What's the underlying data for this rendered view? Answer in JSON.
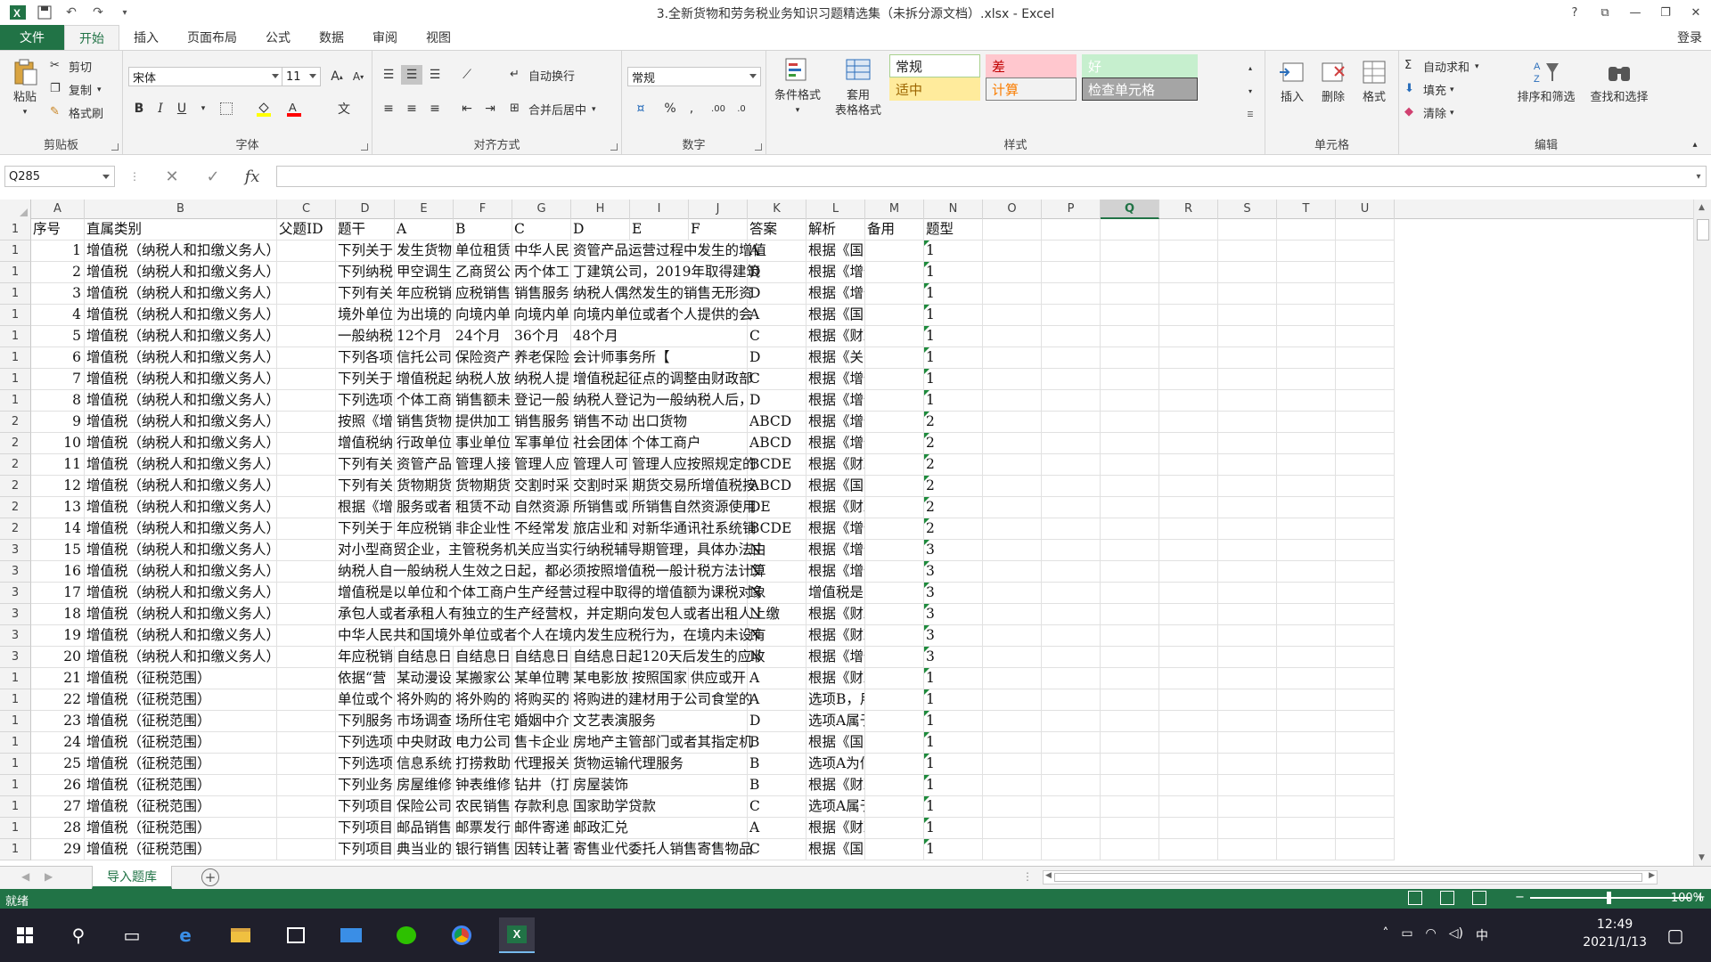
{
  "window": {
    "title": "3.全新货物和劳务税业务知识习题精选集（未拆分源文档）.xlsx - Excel",
    "help": "?",
    "login": "登录"
  },
  "ribbon_tabs": [
    "文件",
    "开始",
    "插入",
    "页面布局",
    "公式",
    "数据",
    "审阅",
    "视图"
  ],
  "clipboard": {
    "paste": "粘贴",
    "cut": "剪切",
    "copy": "复制",
    "painter": "格式刷",
    "label": "剪贴板"
  },
  "font": {
    "name": "宋体",
    "size": "11",
    "label": "字体",
    "bold": "B",
    "italic": "I",
    "underline": "U",
    "grow": "A",
    "shrink": "A",
    "phonetic": "文"
  },
  "alignment": {
    "wrap": "自动换行",
    "merge": "合并后居中",
    "label": "对齐方式"
  },
  "number": {
    "format": "常规",
    "percent": "%",
    "comma": ",",
    "label": "数字"
  },
  "styles": {
    "conditional": "条件格式",
    "table": "套用\n表格格式",
    "label": "样式",
    "cells": [
      {
        "text": "常规",
        "bg": "#ffffff",
        "fg": "#222222",
        "border": "#a9d18e"
      },
      {
        "text": "差",
        "bg": "#ffc7ce",
        "fg": "#c00000",
        "border": "#ffc7ce"
      },
      {
        "text": "好",
        "bg": "#c6efce",
        "fg": "#ffffff",
        "border": "#c6efce"
      },
      {
        "text": "适中",
        "bg": "#ffeb9c",
        "fg": "#9c6500",
        "border": "#ffeb9c"
      },
      {
        "text": "计算",
        "bg": "#f2f2f2",
        "fg": "#fa7d00",
        "border": "#7f7f7f"
      },
      {
        "text": "检查单元格",
        "bg": "#a5a5a5",
        "fg": "#ffffff",
        "border": "#3f3f3f"
      }
    ]
  },
  "cellgroup": {
    "insert": "插入",
    "delete": "删除",
    "format": "格式",
    "label": "单元格"
  },
  "editing": {
    "autosum": "自动求和",
    "fill": "填充",
    "clear": "清除",
    "sort": "排序和筛选",
    "find": "查找和选择",
    "label": "编辑"
  },
  "formula_bar": {
    "name_box": "Q285",
    "fx": "fx",
    "value": ""
  },
  "columns": [
    "A",
    "B",
    "C",
    "D",
    "E",
    "F",
    "G",
    "H",
    "I",
    "J",
    "K",
    "L",
    "M",
    "N",
    "O",
    "P",
    "Q",
    "R",
    "S",
    "T",
    "U"
  ],
  "selected_column": "Q",
  "header_row": [
    "序号",
    "直属类别",
    "父题ID",
    "题干",
    "A",
    "B",
    "C",
    "D",
    "E",
    "F",
    "答案",
    "解析",
    "备用",
    "题型"
  ],
  "rows": [
    {
      "n": "1",
      "a": "1",
      "b": "增值税（纳税人和扣缴义务人）",
      "d": "下列关于扌",
      "e": "发生货物",
      "f": "单位租赁",
      "g": "中华人民",
      "h": "资管产品运营过程中发生的增值",
      "k": "A",
      "l": "根据《国家税务总局"
    },
    {
      "n": "1",
      "a": "2",
      "b": "增值税（纳税人和扣缴义务人）",
      "d": "下列纳税",
      "e": "甲空调生",
      "f": "乙商贸公",
      "g": "丙个体工商",
      "h": "丁建筑公司，2019年取得建筑",
      "k": "D",
      "l": "根据《增值税一般纳"
    },
    {
      "n": "1",
      "a": "3",
      "b": "增值税（纳税人和扣缴义务人）",
      "d": "下列有关",
      "e": "年应税销",
      "f": "应税销售",
      "g": "销售服务",
      "h": "纳税人偶然发生的销售无形资",
      "k": "D",
      "l": "根据《增值税一般纳"
    },
    {
      "n": "1",
      "a": "4",
      "b": "增值税（纳税人和扣缴义务人）",
      "d": "境外单位",
      "e": "为出境的",
      "f": "向境内单",
      "g": "向境内单",
      "h": "向境内单位或者个人提供的会",
      "k": "A",
      "l": "根据《国家税务总局"
    },
    {
      "n": "1",
      "a": "5",
      "b": "增值税（纳税人和扣缴义务人）",
      "d": "一般纳税",
      "e": "12个月",
      "f": "24个月",
      "g": "36个月",
      "h": "48个月",
      "k": "C",
      "l": "根据《财政部、国家"
    },
    {
      "n": "1",
      "a": "6",
      "b": "增值税（纳税人和扣缴义务人）",
      "d": "下列各项",
      "e": "信托公司",
      "f": "保险资产",
      "g": "养老保险",
      "h": "会计师事务所【",
      "k": "D",
      "l": "根据《关于资管产品"
    },
    {
      "n": "1",
      "a": "7",
      "b": "增值税（纳税人和扣缴义务人）",
      "d": "下列关于",
      "e": "增值税起",
      "f": "纳税人放",
      "g": "纳税人提",
      "h": "增值税起征点的调整由财政部",
      "k": "C",
      "l": "根据《增值税暂行条"
    },
    {
      "n": "1",
      "a": "8",
      "b": "增值税（纳税人和扣缴义务人）",
      "d": "下列选项",
      "e": "个体工商",
      "f": "销售额未",
      "g": "登记一般",
      "h": "纳税人登记为一般纳税人后，",
      "k": "D",
      "l": "根据《增值税一般纳"
    },
    {
      "n": "2",
      "a": "9",
      "b": "增值税（纳税人和扣缴义务人）",
      "d": "按照《增",
      "e": "销售货物",
      "f": "提供加工",
      "g": "销售服务",
      "h": "销售不动",
      "i": "出口货物",
      "k": "ABCD",
      "l": "根据《增值税暂行条"
    },
    {
      "n": "2",
      "a": "10",
      "b": "增值税（纳税人和扣缴义务人）",
      "d": "增值税纳",
      "e": "行政单位",
      "f": "事业单位",
      "g": "军事单位",
      "h": "社会团体",
      "i": "个体工商户",
      "k": "ABCD",
      "l": "根据《增值税暂行条"
    },
    {
      "n": "2",
      "a": "11",
      "b": "增值税（纳税人和扣缴义务人）",
      "d": "下列有关",
      "e": "资管产品",
      "f": "管理人接",
      "g": "管理人应",
      "h": "管理人可",
      "i": "管理人应按照规定的",
      "k": "BCDE",
      "l": "根据《财政部、国家"
    },
    {
      "n": "2",
      "a": "12",
      "b": "增值税（纳税人和扣缴义务人）",
      "d": "下列有关",
      "e": "货物期货",
      "f": "货物期货",
      "g": "交割时采",
      "h": "交割时采",
      "i": "期货交易所增值税按",
      "k": "ABCD",
      "l": "根据《国家税务总局"
    },
    {
      "n": "2",
      "a": "13",
      "b": "增值税（纳税人和扣缴义务人）",
      "d": "根据《增",
      "e": "服务或者",
      "f": "租赁不动",
      "g": "自然资源",
      "h": "所销售或",
      "i": "所销售自然资源使用",
      "k": "DE",
      "l": "根据《财政部、国家"
    },
    {
      "n": "2",
      "a": "14",
      "b": "增值税（纳税人和扣缴义务人）",
      "d": "下列关于",
      "e": "年应税销",
      "f": "非企业性",
      "g": "不经常发",
      "h": "旅店业和",
      "i": "对新华通讯社系统销",
      "k": "BCDE",
      "l": "根据《增值税暂行条"
    },
    {
      "n": "3",
      "a": "15",
      "b": "增值税（纳税人和扣缴义务人）",
      "d": "对小型商贸企业，主管税务机关应当实行纳税辅导期管理，具体办法由",
      "k": "N",
      "l": "根据《增值税一般纳"
    },
    {
      "n": "3",
      "a": "16",
      "b": "增值税（纳税人和扣缴义务人）",
      "d": "纳税人自一般纳税人生效之日起，都必须按照增值税一般计税方法计算",
      "k": "N",
      "l": "根据《增值税一般纳"
    },
    {
      "n": "3",
      "a": "17",
      "b": "增值税（纳税人和扣缴义务人）",
      "d": "增值税是以单位和个体工商户生产经营过程中取得的增值额为课税对象",
      "k": "N",
      "l": "增值税是以单位和个"
    },
    {
      "n": "3",
      "a": "18",
      "b": "增值税（纳税人和扣缴义务人）",
      "d": "承包人或者承租人有独立的生产经营权，并定期向发包人或者出租人上缴",
      "k": "N",
      "l": "根据《财政部、国家"
    },
    {
      "n": "3",
      "a": "19",
      "b": "增值税（纳税人和扣缴义务人）",
      "d": "中华人民共和国境外单位或者个人在境内发生应税行为，在境内未设有",
      "k": "N",
      "l": "根据《财政部、国家"
    },
    {
      "n": "3",
      "a": "20",
      "b": "增值税（纳税人和扣缴义务人）",
      "d": "年应税销",
      "e": "自结息日",
      "f": "自结息日",
      "g": "自结息日",
      "h": "自结息日起120天后发生的应收",
      "k": "N",
      "l": "根据《增值税暂行条"
    },
    {
      "n": "1",
      "a": "21",
      "b": "增值税（征税范围）",
      "d": "依据“营",
      "e": "某动漫设",
      "f": "某搬家公",
      "g": "某单位聘",
      "h": "某电影放",
      "i": "按照国家",
      "j": "供应或开",
      "k": "A",
      "l": "根据《财政部、国家"
    },
    {
      "n": "1",
      "a": "22",
      "b": "增值税（征税范围）",
      "d": "单位或个",
      "e": "将外购的",
      "f": "将外购的",
      "g": "将购买的",
      "h": "将购进的建材用于公司食堂的",
      "k": "A",
      "l": "选项B，用购买的货"
    },
    {
      "n": "1",
      "a": "23",
      "b": "增值税（征税范围）",
      "d": "下列服务",
      "e": "市场调查",
      "f": "场所住宅",
      "g": "婚姻中介",
      "h": "文艺表演服务",
      "k": "D",
      "l": "选项A属于鉴证咨询"
    },
    {
      "n": "1",
      "a": "24",
      "b": "增值税（征税范围）",
      "d": "下列选项",
      "e": "中央财政",
      "f": "电力公司",
      "g": "售卡企业",
      "h": "房地产主管部门或者其指定机",
      "k": "B",
      "l": "根据《国家税务总局"
    },
    {
      "n": "1",
      "a": "25",
      "b": "增值税（征税范围）",
      "d": "下列选项",
      "e": "信息系统",
      "f": "打捞救助",
      "g": "代理报关",
      "h": "货物运输代理服务",
      "k": "B",
      "l": "选项A为信息技术服"
    },
    {
      "n": "1",
      "a": "26",
      "b": "增值税（征税范围）",
      "d": "下列业务",
      "e": "房屋维修",
      "f": "钟表维修",
      "g": "钻井（打",
      "h": "房屋装饰",
      "k": "B",
      "l": "根据《财政部、国家"
    },
    {
      "n": "1",
      "a": "27",
      "b": "增值税（征税范围）",
      "d": "下列项目",
      "e": "保险公司",
      "f": "农民销售",
      "g": "存款利息",
      "h": "国家助学贷款",
      "k": "C",
      "l": "选项A属于增值税应"
    },
    {
      "n": "1",
      "a": "28",
      "b": "增值税（征税范围）",
      "d": "下列项目",
      "e": "邮品销售",
      "f": "邮票发行",
      "g": "邮件寄递",
      "h": "邮政汇兑",
      "k": "A",
      "l": "根据《财政部、国家"
    },
    {
      "n": "1",
      "a": "29",
      "b": "增值税（征税范围）",
      "d": "下列项目",
      "e": "典当业的",
      "f": "银行销售",
      "g": "因转让著",
      "h": "寄售业代委托人销售寄售物品",
      "k": "C",
      "l": "根据《国家税务总局"
    }
  ],
  "sheet_tab": "导入题库",
  "status": {
    "ready": "就绪",
    "zoom": "100%"
  },
  "taskbar": {
    "time": "12:49",
    "date": "2021/1/13",
    "ime": "中"
  },
  "colors": {
    "excel_green": "#217346",
    "taskbar": "#1f1f2b"
  }
}
